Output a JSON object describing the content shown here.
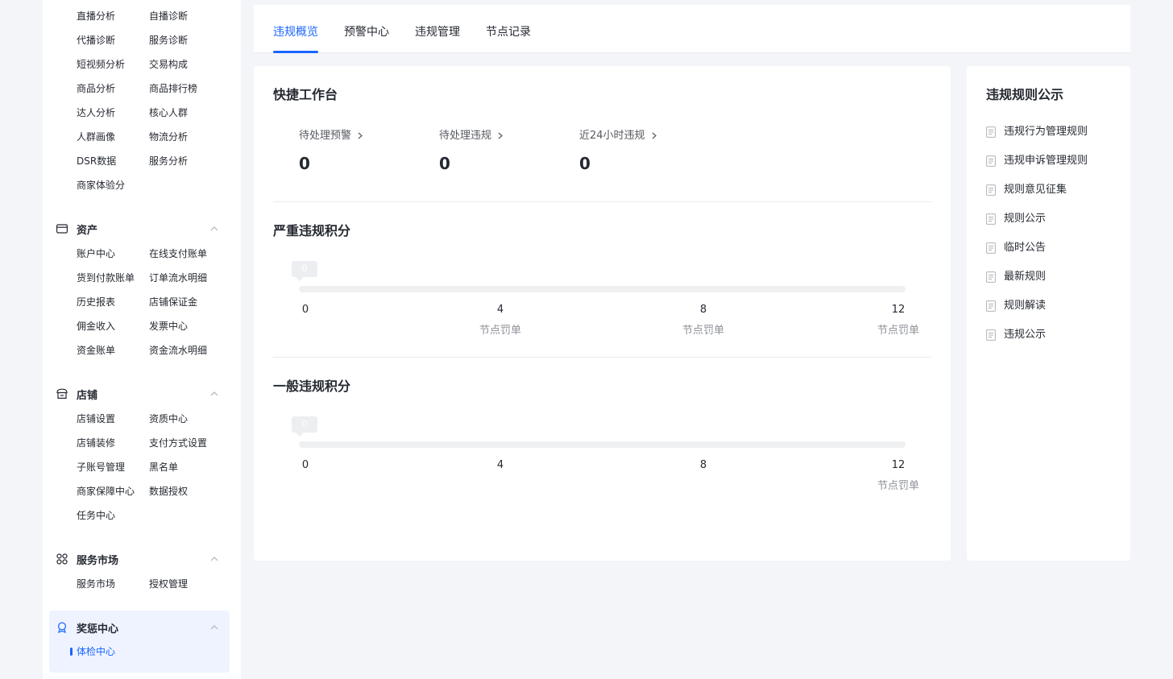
{
  "sidebar": {
    "top_items": [
      [
        "直播分析",
        "自播诊断"
      ],
      [
        "代播诊断",
        "服务诊断"
      ],
      [
        "短视频分析",
        "交易构成"
      ],
      [
        "商品分析",
        "商品排行榜"
      ],
      [
        "达人分析",
        "核心人群"
      ],
      [
        "人群画像",
        "物流分析"
      ],
      [
        "DSR数据",
        "服务分析"
      ],
      [
        "商家体验分",
        ""
      ]
    ],
    "sections": {
      "assets": {
        "title": "资产",
        "items": [
          [
            "账户中心",
            "在线支付账单"
          ],
          [
            "货到付款账单",
            "订单流水明细"
          ],
          [
            "历史报表",
            "店铺保证金"
          ],
          [
            "佣金收入",
            "发票中心"
          ],
          [
            "资金账单",
            "资金流水明细"
          ]
        ]
      },
      "shop": {
        "title": "店铺",
        "items": [
          [
            "店铺设置",
            "资质中心"
          ],
          [
            "店铺装修",
            "支付方式设置"
          ],
          [
            "子账号管理",
            "黑名单"
          ],
          [
            "商家保障中心",
            "数据授权"
          ],
          [
            "任务中心",
            ""
          ]
        ]
      },
      "market": {
        "title": "服务市场",
        "items": [
          [
            "服务市场",
            "授权管理"
          ]
        ]
      },
      "reward": {
        "title": "奖惩中心",
        "active_item": "体检中心"
      }
    }
  },
  "tabs": [
    "违规概览",
    "预警中心",
    "违规管理",
    "节点记录"
  ],
  "active_tab": 0,
  "workbench": {
    "title": "快捷工作台",
    "stats": [
      {
        "label": "待处理预警",
        "value": "0"
      },
      {
        "label": "待处理违规",
        "value": "0"
      },
      {
        "label": "近24小时违规",
        "value": "0"
      }
    ]
  },
  "serious": {
    "title": "严重违规积分",
    "current": "0",
    "ticks": [
      "0",
      "4",
      "8",
      "12"
    ],
    "tick_labels": [
      "",
      "节点罚单",
      "节点罚单",
      "节点罚单"
    ]
  },
  "general": {
    "title": "一般违规积分",
    "current": "0",
    "ticks": [
      "0",
      "4",
      "8",
      "12"
    ],
    "tick_labels": [
      "",
      "",
      "",
      "节点罚单"
    ]
  },
  "rules_panel": {
    "title": "违规规则公示",
    "items": [
      "违规行为管理规则",
      "违规申诉管理规则",
      "规则意见征集",
      "规则公示",
      "临时公告",
      "最新规则",
      "规则解读",
      "违规公示"
    ]
  },
  "colors": {
    "accent": "#1966ff",
    "text": "#252931",
    "muted": "#8e9197",
    "track": "#eef0f2",
    "page_bg": "#f4f5f9"
  }
}
